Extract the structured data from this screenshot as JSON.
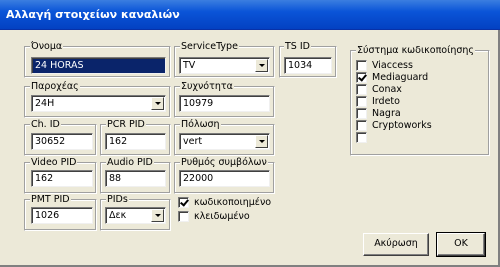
{
  "window": {
    "title": "Αλλαγή στοιχείων καναλιών"
  },
  "fields": {
    "name": {
      "label": "Όνομα",
      "value": "24 HORAS"
    },
    "service_type": {
      "label": "ServiceType",
      "value": "TV"
    },
    "ts_id": {
      "label": "TS ID",
      "value": "1034"
    },
    "provider": {
      "label": "Παροχέας",
      "value": "24H"
    },
    "frequency": {
      "label": "Συχνότητα",
      "value": "10979"
    },
    "ch_id": {
      "label": "Ch. ID",
      "value": "30652"
    },
    "pcr_pid": {
      "label": "PCR PID",
      "value": "162"
    },
    "polarization": {
      "label": "Πόλωση",
      "value": "vert"
    },
    "video_pid": {
      "label": "Video PID",
      "value": "162"
    },
    "audio_pid": {
      "label": "Audio PID",
      "value": "88"
    },
    "symbol_rate": {
      "label": "Ρυθμός συμβόλων",
      "value": "22000"
    },
    "pmt_pid": {
      "label": "PMT PID",
      "value": "1026"
    },
    "pids": {
      "label": "PIDs",
      "value": "Δεκ"
    }
  },
  "flags": {
    "encrypted": {
      "label": "κωδικοποιημένο",
      "checked": true
    },
    "locked": {
      "label": "κλειδωμένο",
      "checked": false
    }
  },
  "encryption": {
    "label": "Σύστημα κωδικοποίησης",
    "systems": [
      {
        "label": "Viaccess",
        "checked": false
      },
      {
        "label": "Mediaguard",
        "checked": true
      },
      {
        "label": "Conax",
        "checked": false
      },
      {
        "label": "Irdeto",
        "checked": false
      },
      {
        "label": "Nagra",
        "checked": false
      },
      {
        "label": "Cryptoworks",
        "checked": false
      },
      {
        "label": "",
        "checked": false
      }
    ]
  },
  "buttons": {
    "cancel": "Ακύρωση",
    "ok": "OK"
  }
}
